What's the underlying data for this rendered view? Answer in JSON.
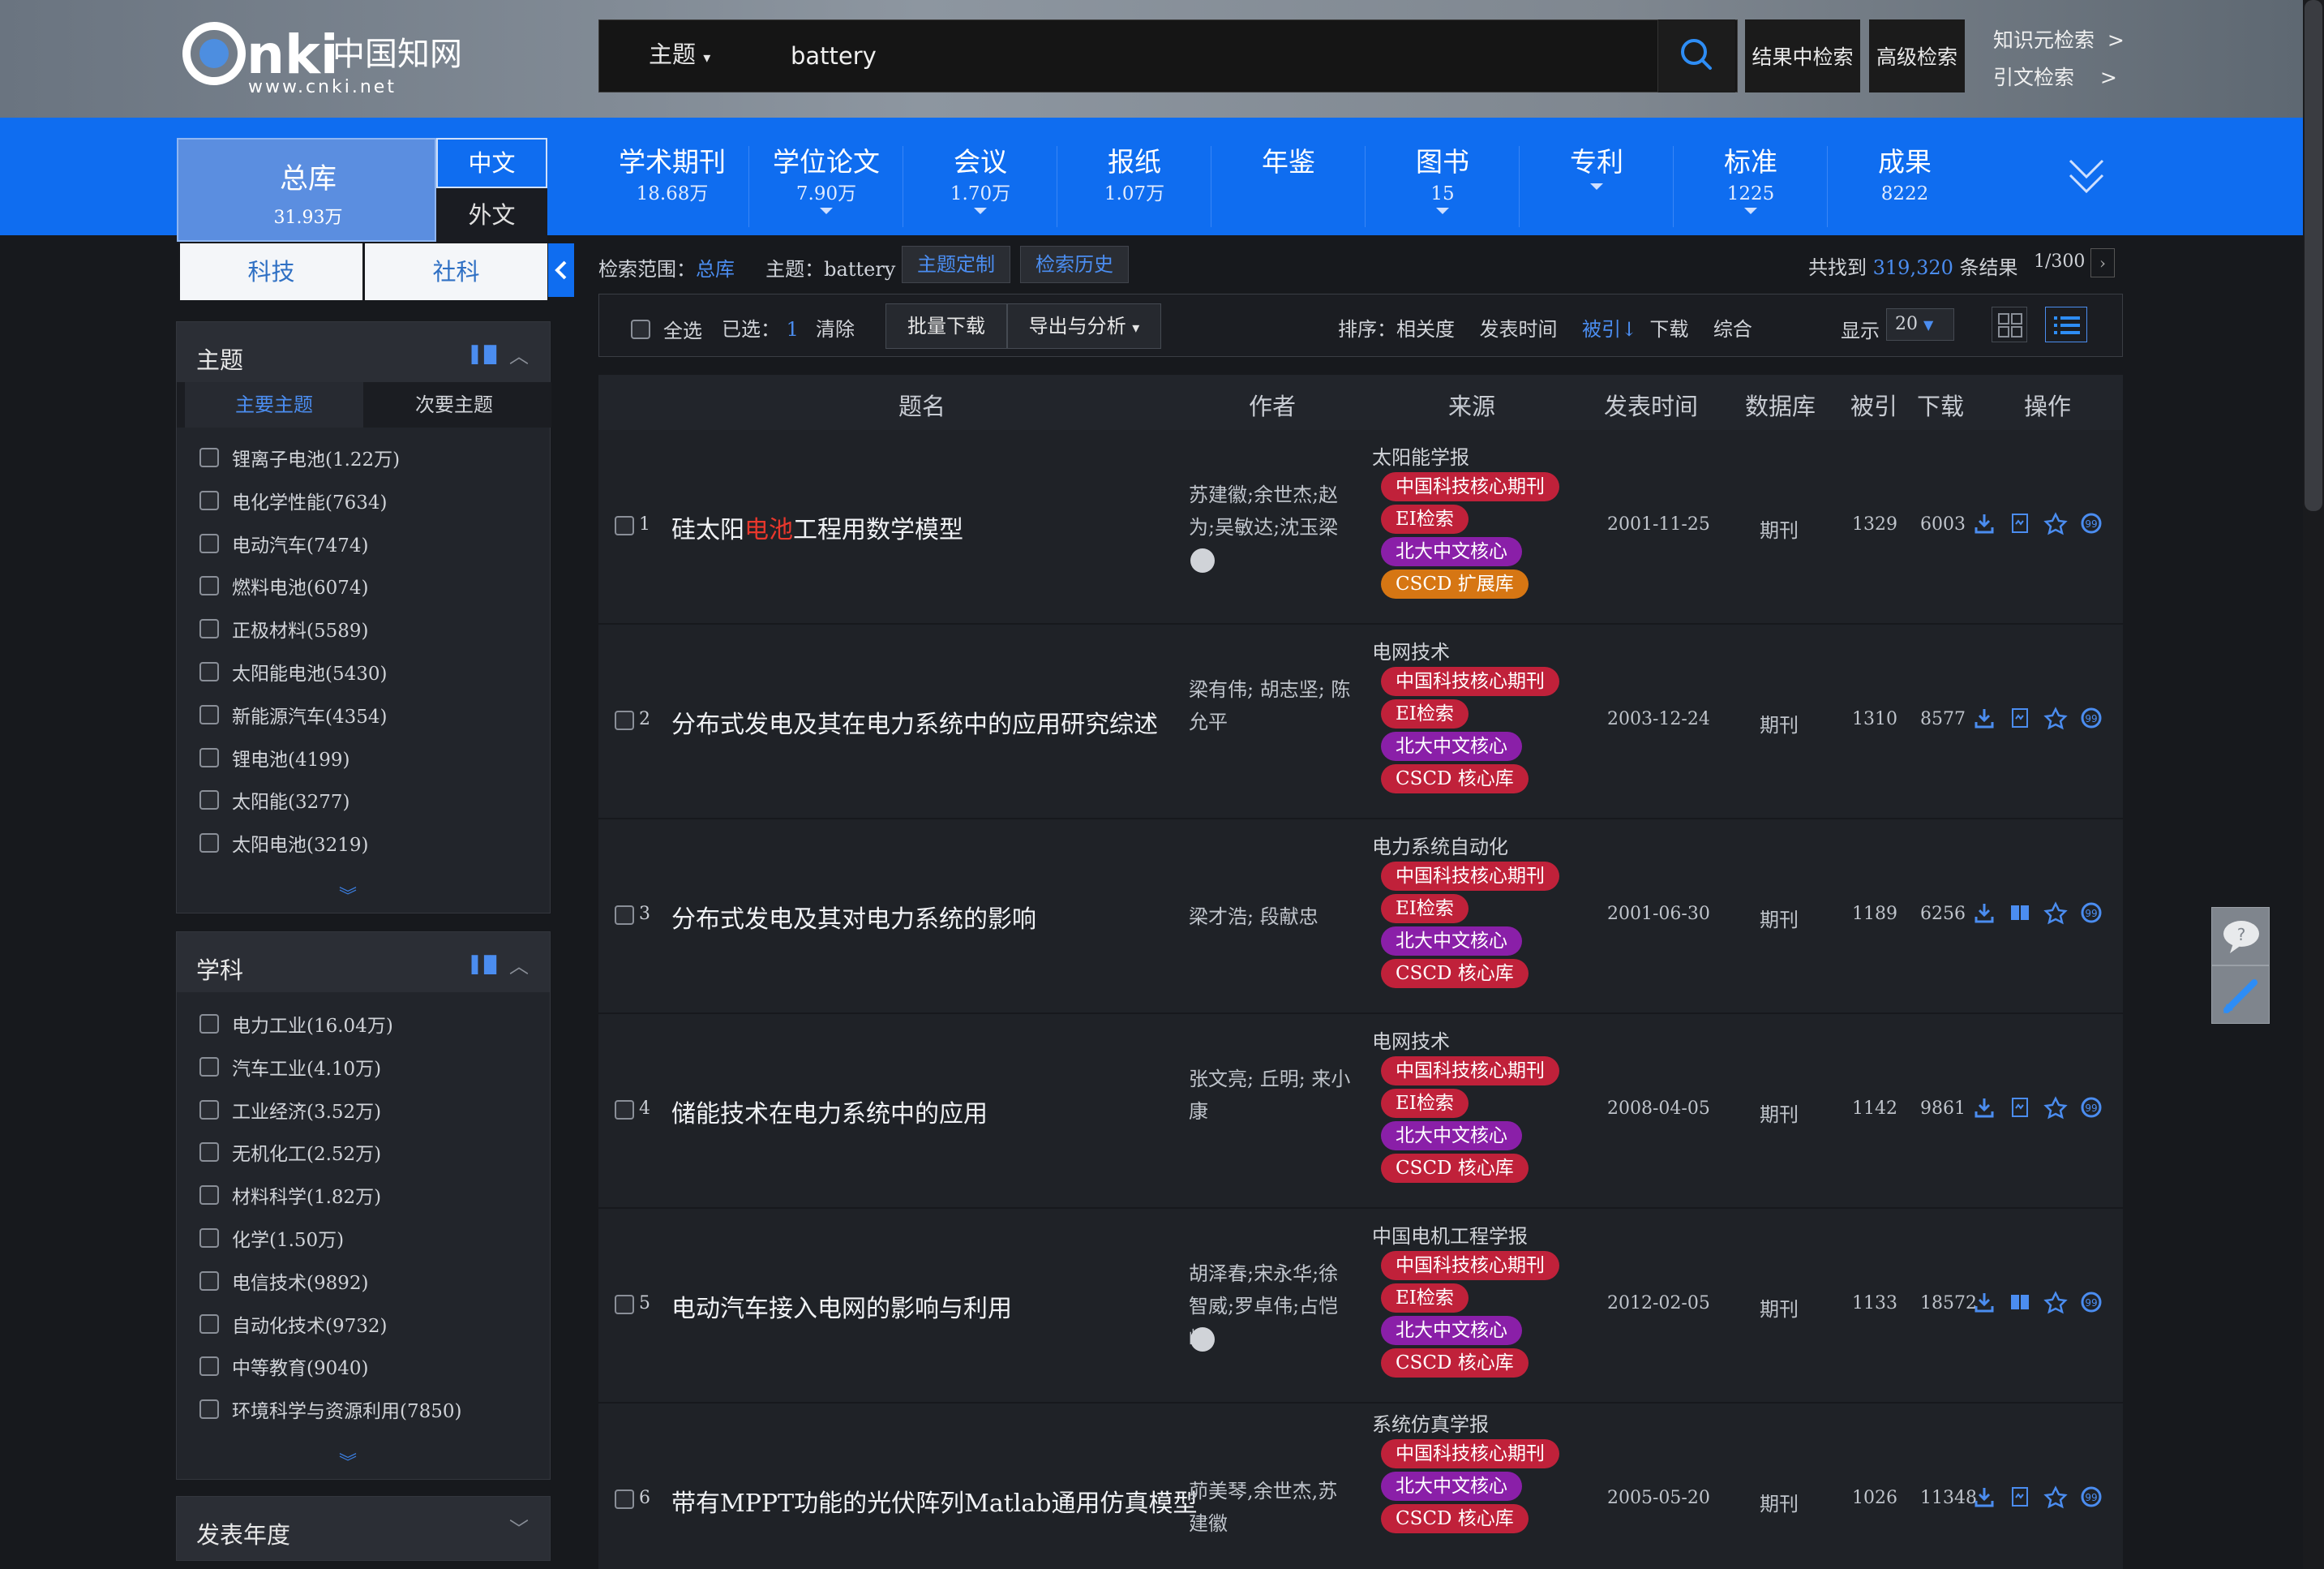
{
  "header": {
    "logo_text": "CNKi中国知网",
    "logo_url_text": "www.cnki.net",
    "search_field": "主题",
    "search_value": "battery",
    "btn_within": "结果中检索",
    "btn_advanced": "高级检索",
    "link_knowledge": "知识元检索",
    "link_citation": "引文检索"
  },
  "nav": {
    "all_label": "总库",
    "all_count": "31.93万",
    "zh": "中文",
    "en": "外文",
    "tabs": [
      {
        "label": "学术期刊",
        "count": "18.68万",
        "arrow": false
      },
      {
        "label": "学位论文",
        "count": "7.90万",
        "arrow": true
      },
      {
        "label": "会议",
        "count": "1.70万",
        "arrow": true
      },
      {
        "label": "报纸",
        "count": "1.07万",
        "arrow": false
      },
      {
        "label": "年鉴",
        "count": "",
        "arrow": false
      },
      {
        "label": "图书",
        "count": "15",
        "arrow": true
      },
      {
        "label": "专利",
        "count": "",
        "arrow": true
      },
      {
        "label": "标准",
        "count": "1225",
        "arrow": true
      },
      {
        "label": "成果",
        "count": "8222",
        "arrow": false
      }
    ]
  },
  "sidebar": {
    "tab_sci": "科技",
    "tab_soc": "社科",
    "topic_title": "主题",
    "topic_main": "主要主题",
    "topic_sub": "次要主题",
    "topics": [
      "锂离子电池(1.22万)",
      "电化学性能(7634)",
      "电动汽车(7474)",
      "燃料电池(6074)",
      "正极材料(5589)",
      "太阳能电池(5430)",
      "新能源汽车(4354)",
      "锂电池(4199)",
      "太阳能(3277)",
      "太阳电池(3219)"
    ],
    "subject_title": "学科",
    "subjects": [
      "电力工业(16.04万)",
      "汽车工业(4.10万)",
      "工业经济(3.52万)",
      "无机化工(2.52万)",
      "材料科学(1.82万)",
      "化学(1.50万)",
      "电信技术(9892)",
      "自动化技术(9732)",
      "中等教育(9040)",
      "环境科学与资源利用(7850)"
    ],
    "year_title": "发表年度"
  },
  "toolbar": {
    "scope_label": "检索范围：",
    "scope_value": "总库",
    "topic_label": "主题：",
    "topic_value": "battery",
    "btn_custom": "主题定制",
    "btn_history": "检索历史",
    "found_prefix": "共找到",
    "found_count": "319,320",
    "found_suffix": "条结果",
    "page": "1/300",
    "select_all": "全选",
    "selected_label": "已选：",
    "selected_count": "1",
    "clear": "清除",
    "batch_download": "批量下载",
    "export": "导出与分析",
    "sort_label": "排序：",
    "sort_relevance": "相关度",
    "sort_date": "发表时间",
    "sort_cited": "被引",
    "sort_download": "下载",
    "sort_overall": "综合",
    "display_label": "显示",
    "display_value": "20"
  },
  "table": {
    "headers": {
      "title": "题名",
      "author": "作者",
      "source": "来源",
      "date": "发表时间",
      "db": "数据库",
      "cite": "被引",
      "download": "下载",
      "ops": "操作"
    },
    "rows": [
      {
        "num": "1",
        "title_pre": "硅太阳",
        "title_hl": "电池",
        "title_post": "工程用数学模型",
        "author": "苏建徽;余世杰;赵为;吴敏达;沈玉梁",
        "journal": "太阳能学报",
        "tags": [
          {
            "t": "中国科技核心期刊",
            "c": "red"
          },
          {
            "t": "EI检索",
            "c": "red"
          },
          {
            "t": "北大中文核心",
            "c": "purple"
          },
          {
            "t": "CSCD 扩展库",
            "c": "orange"
          }
        ],
        "date": "2001-11-25",
        "db": "期刊",
        "cite": "1329",
        "download": "6003"
      },
      {
        "num": "2",
        "title_pre": "分布式发电及其在电力系统中的应用研究综述",
        "title_hl": "",
        "title_post": "",
        "author": "梁有伟; 胡志坚; 陈允平",
        "journal": "电网技术",
        "tags": [
          {
            "t": "中国科技核心期刊",
            "c": "red"
          },
          {
            "t": "EI检索",
            "c": "red"
          },
          {
            "t": "北大中文核心",
            "c": "purple"
          },
          {
            "t": "CSCD 核心库",
            "c": "red"
          }
        ],
        "date": "2003-12-24",
        "db": "期刊",
        "cite": "1310",
        "download": "8577"
      },
      {
        "num": "3",
        "title_pre": "分布式发电及其对电力系统的影响",
        "title_hl": "",
        "title_post": "",
        "author": "梁才浩; 段献忠",
        "journal": "电力系统自动化",
        "tags": [
          {
            "t": "中国科技核心期刊",
            "c": "red"
          },
          {
            "t": "EI检索",
            "c": "red"
          },
          {
            "t": "北大中文核心",
            "c": "purple"
          },
          {
            "t": "CSCD 核心库",
            "c": "red"
          }
        ],
        "date": "2001-06-30",
        "db": "期刊",
        "cite": "1189",
        "download": "6256"
      },
      {
        "num": "4",
        "title_pre": "储能技术在电力系统中的应用",
        "title_hl": "",
        "title_post": "",
        "author": "张文亮; 丘明; 来小康",
        "journal": "电网技术",
        "tags": [
          {
            "t": "中国科技核心期刊",
            "c": "red"
          },
          {
            "t": "EI检索",
            "c": "red"
          },
          {
            "t": "北大中文核心",
            "c": "purple"
          },
          {
            "t": "CSCD 核心库",
            "c": "red"
          }
        ],
        "date": "2008-04-05",
        "db": "期刊",
        "cite": "1142",
        "download": "9861"
      },
      {
        "num": "5",
        "title_pre": "电动汽车接入电网的影响与利用",
        "title_hl": "",
        "title_post": "",
        "author": "胡泽春;宋永华;徐智威;罗卓伟;占恺峤",
        "journal": "中国电机工程学报",
        "tags": [
          {
            "t": "中国科技核心期刊",
            "c": "red"
          },
          {
            "t": "EI检索",
            "c": "red"
          },
          {
            "t": "北大中文核心",
            "c": "purple"
          },
          {
            "t": "CSCD 核心库",
            "c": "red"
          }
        ],
        "date": "2012-02-05",
        "db": "期刊",
        "cite": "1133",
        "download": "18572"
      },
      {
        "num": "6",
        "title_pre": "带有MPPT功能的光伏阵列Matlab通用仿真模型",
        "title_hl": "",
        "title_post": "",
        "author": "茆美琴,余世杰,苏建徽",
        "journal": "系统仿真学报",
        "tags": [
          {
            "t": "中国科技核心期刊",
            "c": "red"
          },
          {
            "t": "北大中文核心",
            "c": "purple"
          },
          {
            "t": "CSCD 核心库",
            "c": "red"
          }
        ],
        "date": "2005-05-20",
        "db": "期刊",
        "cite": "1026",
        "download": "11348"
      }
    ]
  }
}
